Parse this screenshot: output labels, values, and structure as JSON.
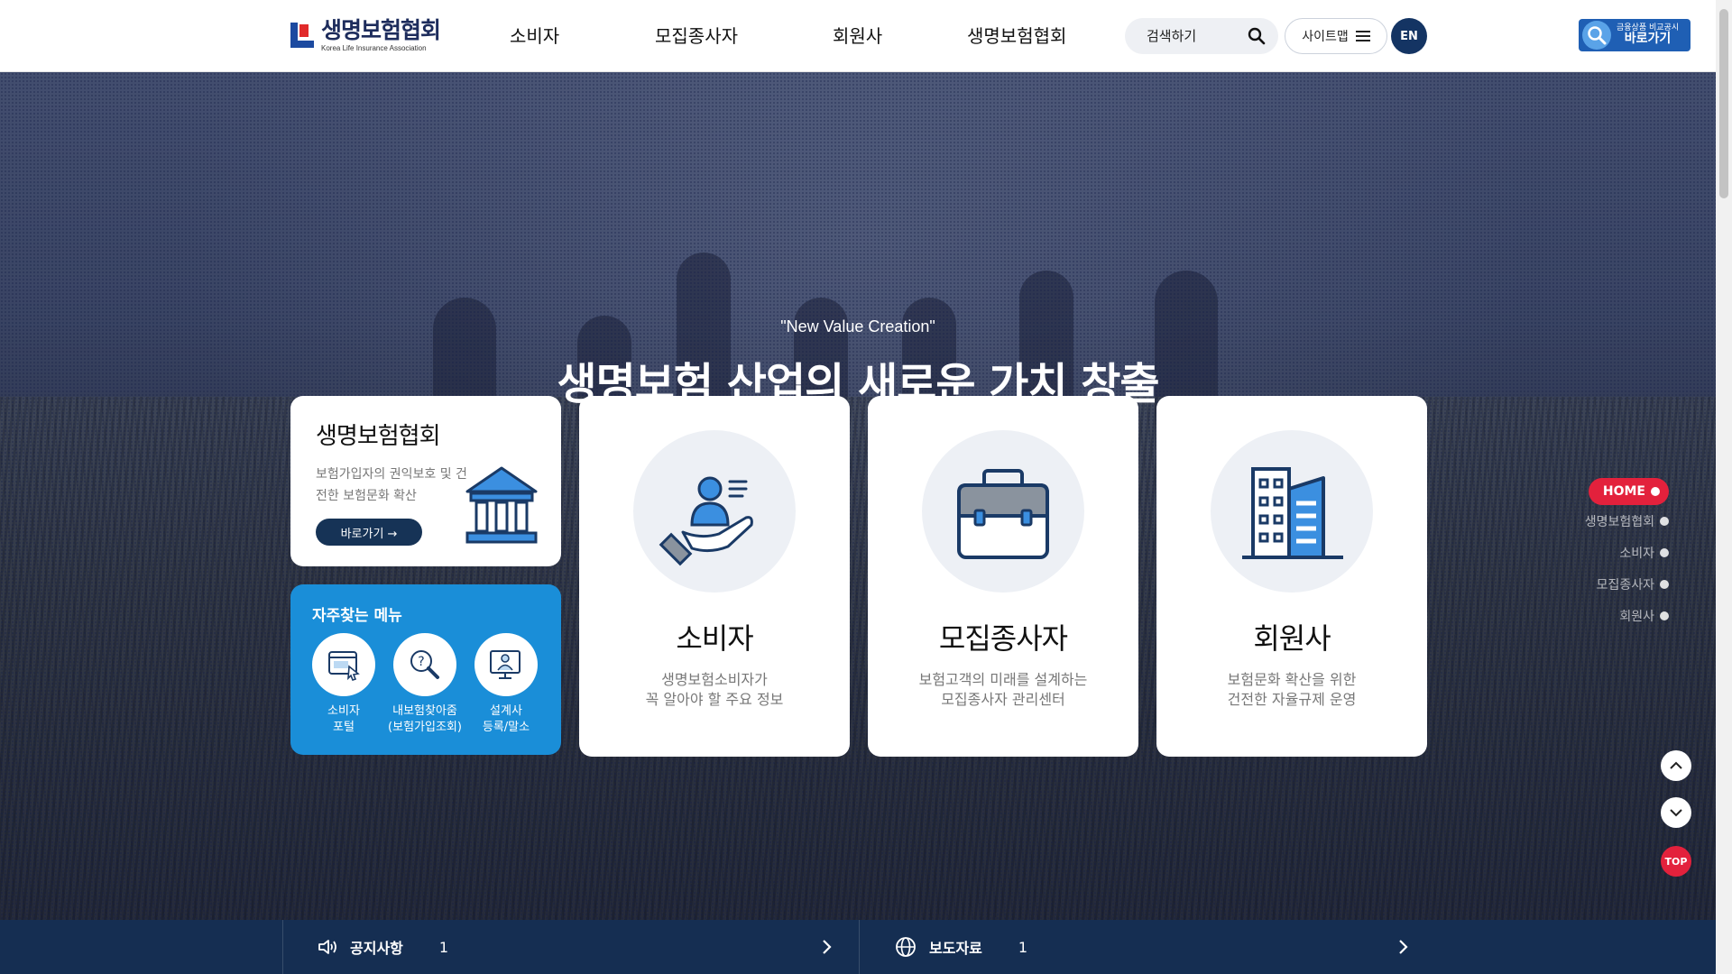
{
  "header": {
    "logo": {
      "name": "생명보험협회",
      "eng": "Korea Life Insurance Association"
    },
    "nav": [
      "소비자",
      "모집종사자",
      "회원사",
      "생명보험협회"
    ],
    "search_placeholder": "검색하기",
    "sitemap_label": "사이트맵",
    "lang_label": "EN",
    "compare": {
      "line1": "금융상품 비교공시",
      "line2": "바로가기"
    }
  },
  "hero": {
    "slogan_en": "\"New Value Creation\"",
    "slogan_ko": "생명보험 산업의 새로운 가치 창출"
  },
  "association_card": {
    "title": "생명보험협회",
    "desc": "보험가입자의 권익보호 및 건전한 보험문화 확산",
    "button": "바로가기 →"
  },
  "quick_menu": {
    "title": "자주찾는 메뉴",
    "items": [
      {
        "line1": "소비자",
        "line2": "포털",
        "icon": "browser-cursor-icon"
      },
      {
        "line1": "내보험찾아줌",
        "line2": "(보험가입조회)",
        "icon": "magnifier-question-icon"
      },
      {
        "line1": "설계사",
        "line2": "등록/말소",
        "icon": "monitor-person-icon"
      }
    ]
  },
  "big_cards": [
    {
      "title": "소비자",
      "desc1": "생명보험소비자가",
      "desc2": "꼭 알아야 할 주요 정보",
      "icon": "hand-person-icon"
    },
    {
      "title": "모집종사자",
      "desc1": "보험고객의 미래를 설계하는",
      "desc2": "모집종사자 관리센터",
      "icon": "briefcase-icon"
    },
    {
      "title": "회원사",
      "desc1": "보험문화 확산을 위한",
      "desc2": "건전한 자율규제 운영",
      "icon": "buildings-icon"
    }
  ],
  "side_nav": [
    {
      "label": "HOME",
      "active": true
    },
    {
      "label": "생명보험협회",
      "active": false
    },
    {
      "label": "소비자",
      "active": false
    },
    {
      "label": "모집종사자",
      "active": false
    },
    {
      "label": "회원사",
      "active": false
    }
  ],
  "top_label": "TOP",
  "news": [
    {
      "label": "공지사항",
      "count": "1",
      "icon": "speaker-icon"
    },
    {
      "label": "보도자료",
      "count": "1",
      "icon": "globe-icon"
    }
  ],
  "colors": {
    "navy": "#163356",
    "accent_red": "#e3213c",
    "quick_blue": "#1a8ed8",
    "news_bar": "#152e52"
  }
}
